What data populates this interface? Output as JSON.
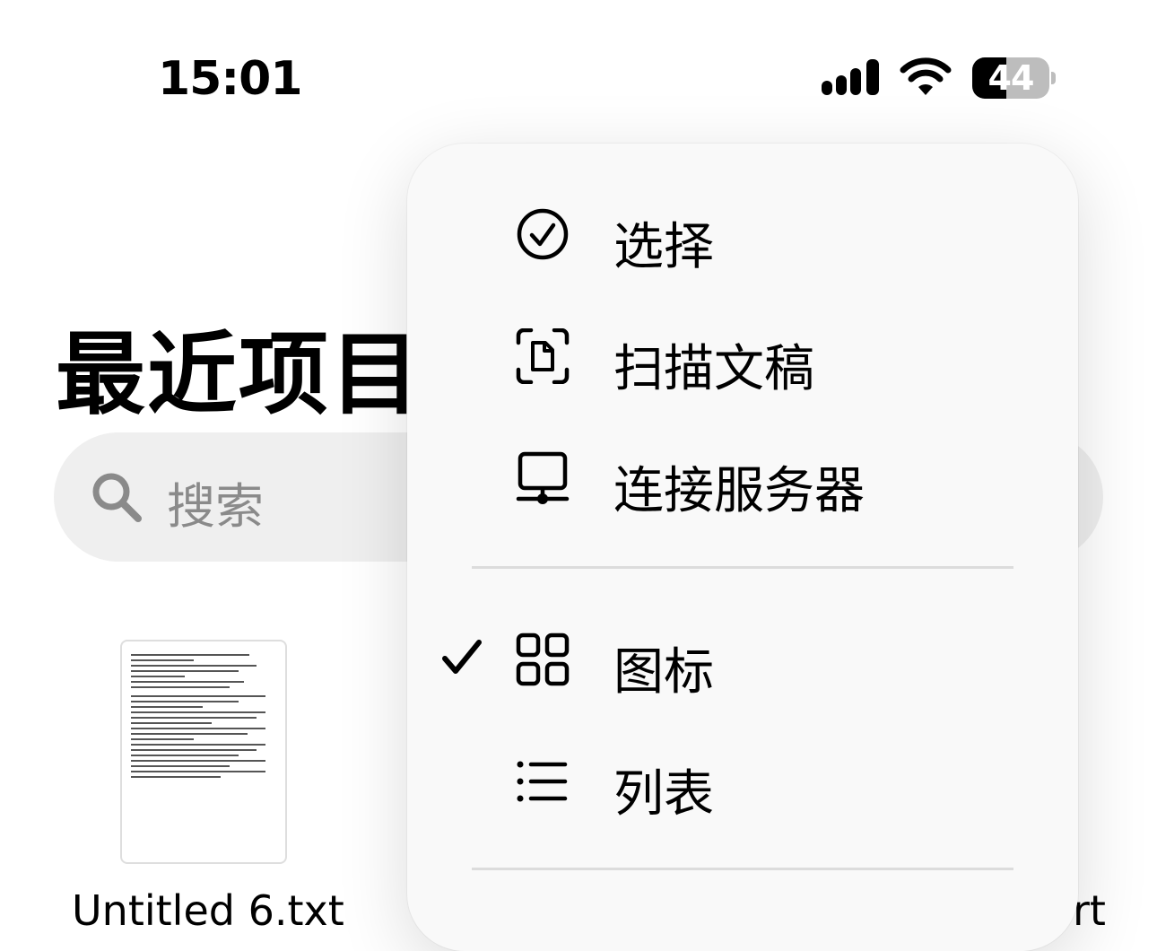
{
  "status_bar": {
    "time": "15:01",
    "battery_percent": "44",
    "battery_level": 0.44,
    "icons": [
      "signal-icon",
      "wifi-icon",
      "battery-icon"
    ]
  },
  "page": {
    "title": "最近项目",
    "search": {
      "placeholder": "搜索",
      "icon": "search-icon"
    },
    "files": [
      {
        "name": "Untitled 6.txt",
        "icon": "document-thumbnail"
      },
      {
        "name_partial": "rt"
      }
    ]
  },
  "menu": {
    "items": [
      {
        "label": "选择",
        "icon": "checkmark-circle-icon"
      },
      {
        "label": "扫描文稿",
        "icon": "document-scan-icon"
      },
      {
        "label": "连接服务器",
        "icon": "server-monitor-icon"
      },
      {
        "label": "图标",
        "icon": "grid-icon",
        "selected": true
      },
      {
        "label": "列表",
        "icon": "list-icon",
        "selected": false
      }
    ]
  },
  "colors": {
    "search_bg": "#efefef",
    "menu_bg": "#f9f9f9",
    "placeholder": "#8a8a8a"
  }
}
